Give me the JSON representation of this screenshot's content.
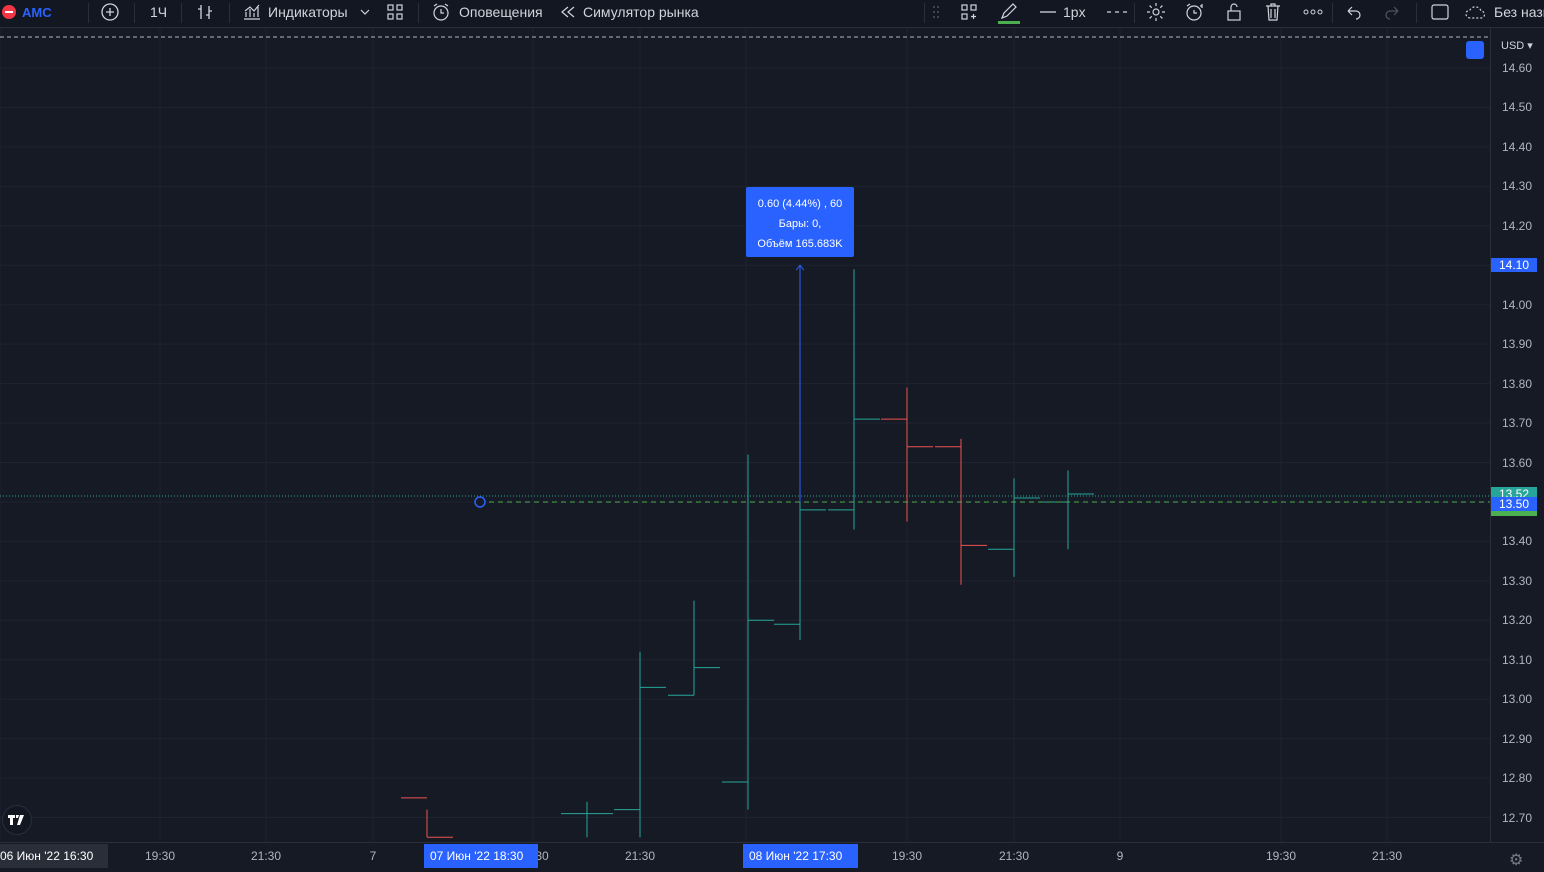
{
  "toolbar": {
    "symbol": "AMC",
    "interval": "1Ч",
    "indicators_label": "Индикаторы",
    "alerts_label": "Оповещения",
    "replay_label": "Симулятор рынка",
    "line_width_label": "1px",
    "layout_name": "Без назв"
  },
  "tooltip": {
    "line1": "0.60 (4.44%) , 60",
    "line2": "Бары: 0,",
    "line3": "Объём 165.683K"
  },
  "price_scale": {
    "currency": "USD",
    "ticks": [
      "14.60",
      "14.50",
      "14.40",
      "14.30",
      "14.20",
      "14.00",
      "13.90",
      "13.80",
      "13.70",
      "13.60",
      "13.40",
      "13.30",
      "13.20",
      "13.10",
      "13.00",
      "12.90",
      "12.80",
      "12.70"
    ],
    "highlight_label": "14.10",
    "current_label": "13.50",
    "hidden_label": "13.52",
    "highlight_color": "#2962ff",
    "current_color": "#4caf50"
  },
  "time_axis": {
    "start_label": "06 Июн '22   16:30",
    "ticks": [
      "19:30",
      "21:30",
      "7",
      "30",
      "21:30",
      "19:30",
      "21:30",
      "9",
      "19:30",
      "21:30"
    ],
    "label_a": "07 Июн '22   18:30",
    "label_b": "08 Июн '22   17:30"
  },
  "chart_data": {
    "type": "ohlc",
    "up_color": "#26a69a",
    "down_color": "#ef5350",
    "ylim": [
      12.65,
      14.68
    ],
    "bars": [
      {
        "o": 12.75,
        "h": 12.72,
        "l": 12.65,
        "c": 12.65,
        "dir": "down"
      },
      {
        "o": 12.71,
        "h": 12.74,
        "l": 12.65,
        "c": 12.71,
        "dir": "up"
      },
      {
        "o": 12.72,
        "h": 13.12,
        "l": 12.65,
        "c": 13.03,
        "dir": "up"
      },
      {
        "o": 13.01,
        "h": 13.25,
        "l": 13.01,
        "c": 13.08,
        "dir": "up"
      },
      {
        "o": 12.79,
        "h": 13.62,
        "l": 12.72,
        "c": 13.2,
        "dir": "up"
      },
      {
        "o": 13.19,
        "h": 14.1,
        "l": 13.15,
        "c": 13.48,
        "dir": "up"
      },
      {
        "o": 13.48,
        "h": 14.09,
        "l": 13.43,
        "c": 13.71,
        "dir": "up"
      },
      {
        "o": 13.71,
        "h": 13.79,
        "l": 13.45,
        "c": 13.64,
        "dir": "down"
      },
      {
        "o": 13.64,
        "h": 13.66,
        "l": 13.29,
        "c": 13.39,
        "dir": "down"
      },
      {
        "o": 13.38,
        "h": 13.56,
        "l": 13.31,
        "c": 13.51,
        "dir": "up"
      },
      {
        "o": 13.5,
        "h": 13.58,
        "l": 13.38,
        "c": 13.52,
        "dir": "up"
      }
    ],
    "measure_from": 13.5,
    "measure_to": 14.1
  }
}
